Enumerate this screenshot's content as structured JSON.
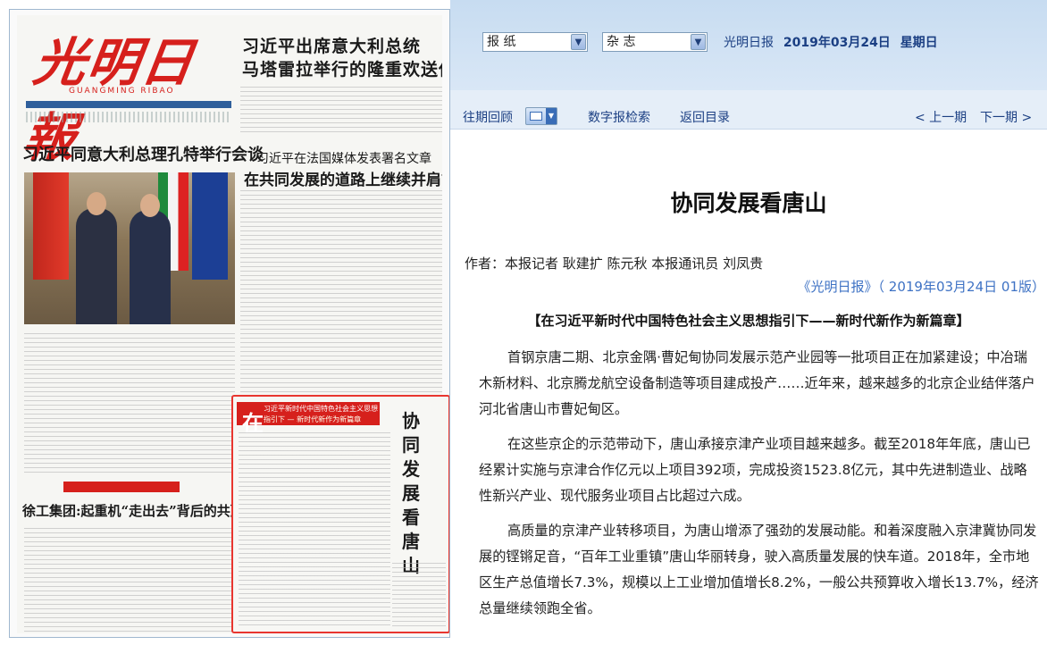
{
  "newspaper": {
    "masthead_logo": "光明日報",
    "masthead_pinyin": "GUANGMING RIBAO",
    "headlines": {
      "top_line1": "习近平出席意大利总统",
      "top_line2": "马塔雷拉举行的隆重欢送仪式",
      "mid_line1": "习近平在法国媒体发表署名文章",
      "mid_line2": "在共同发展的道路上继续并肩前行",
      "left_main": "习近平同意大利总理孔特举行会谈",
      "left_bottom": "徐工集团:起重机“走出去”背后的共赢之路"
    },
    "highlight": {
      "banner_big": "在",
      "banner_line1": "习近平新时代中国特色社会主义思想",
      "banner_line2": "指引下 — 新时代新作为新篇章",
      "vertical_title": "协同发展看唐山"
    }
  },
  "toolbar": {
    "select_newspaper": "报 纸",
    "select_magazine": "杂 志",
    "paper_name": "光明日报",
    "date": "2019年03月24日",
    "weekday": "星期日"
  },
  "nav": {
    "past_issues": "往期回顾",
    "digital_search": "数字报检索",
    "back_to_toc": "返回目录",
    "prev_issue": "< 上一期",
    "next_issue": "下一期 >"
  },
  "article": {
    "title": "协同发展看唐山",
    "author": "作者：本报记者 耿建扩 陈元秋 本报通讯员 刘凤贵",
    "source": "《光明日报》（ 2019年03月24日 01版）",
    "column": "【在习近平新时代中国特色社会主义思想指引下——新时代新作为新篇章】",
    "paragraphs": [
      "首钢京唐二期、北京金隅·曹妃甸协同发展示范产业园等一批项目正在加紧建设；中冶瑞木新材料、北京腾龙航空设备制造等项目建成投产……近年来，越来越多的北京企业结伴落户河北省唐山市曹妃甸区。",
      "在这些京企的示范带动下，唐山承接京津产业项目越来越多。截至2018年年底，唐山已经累计实施与京津合作亿元以上项目392项，完成投资1523.8亿元，其中先进制造业、战略性新兴产业、现代服务业项目占比超过六成。",
      "高质量的京津产业转移项目，为唐山增添了强劲的发展动能。和着深度融入京津冀协同发展的铿锵足音，“百年工业重镇”唐山华丽转身，驶入高质量发展的快车道。2018年，全市地区生产总值增长7.3%，规模以上工业增加值增长8.2%，一般公共预算收入增长13.7%，经济总量继续领跑全省。"
    ]
  }
}
